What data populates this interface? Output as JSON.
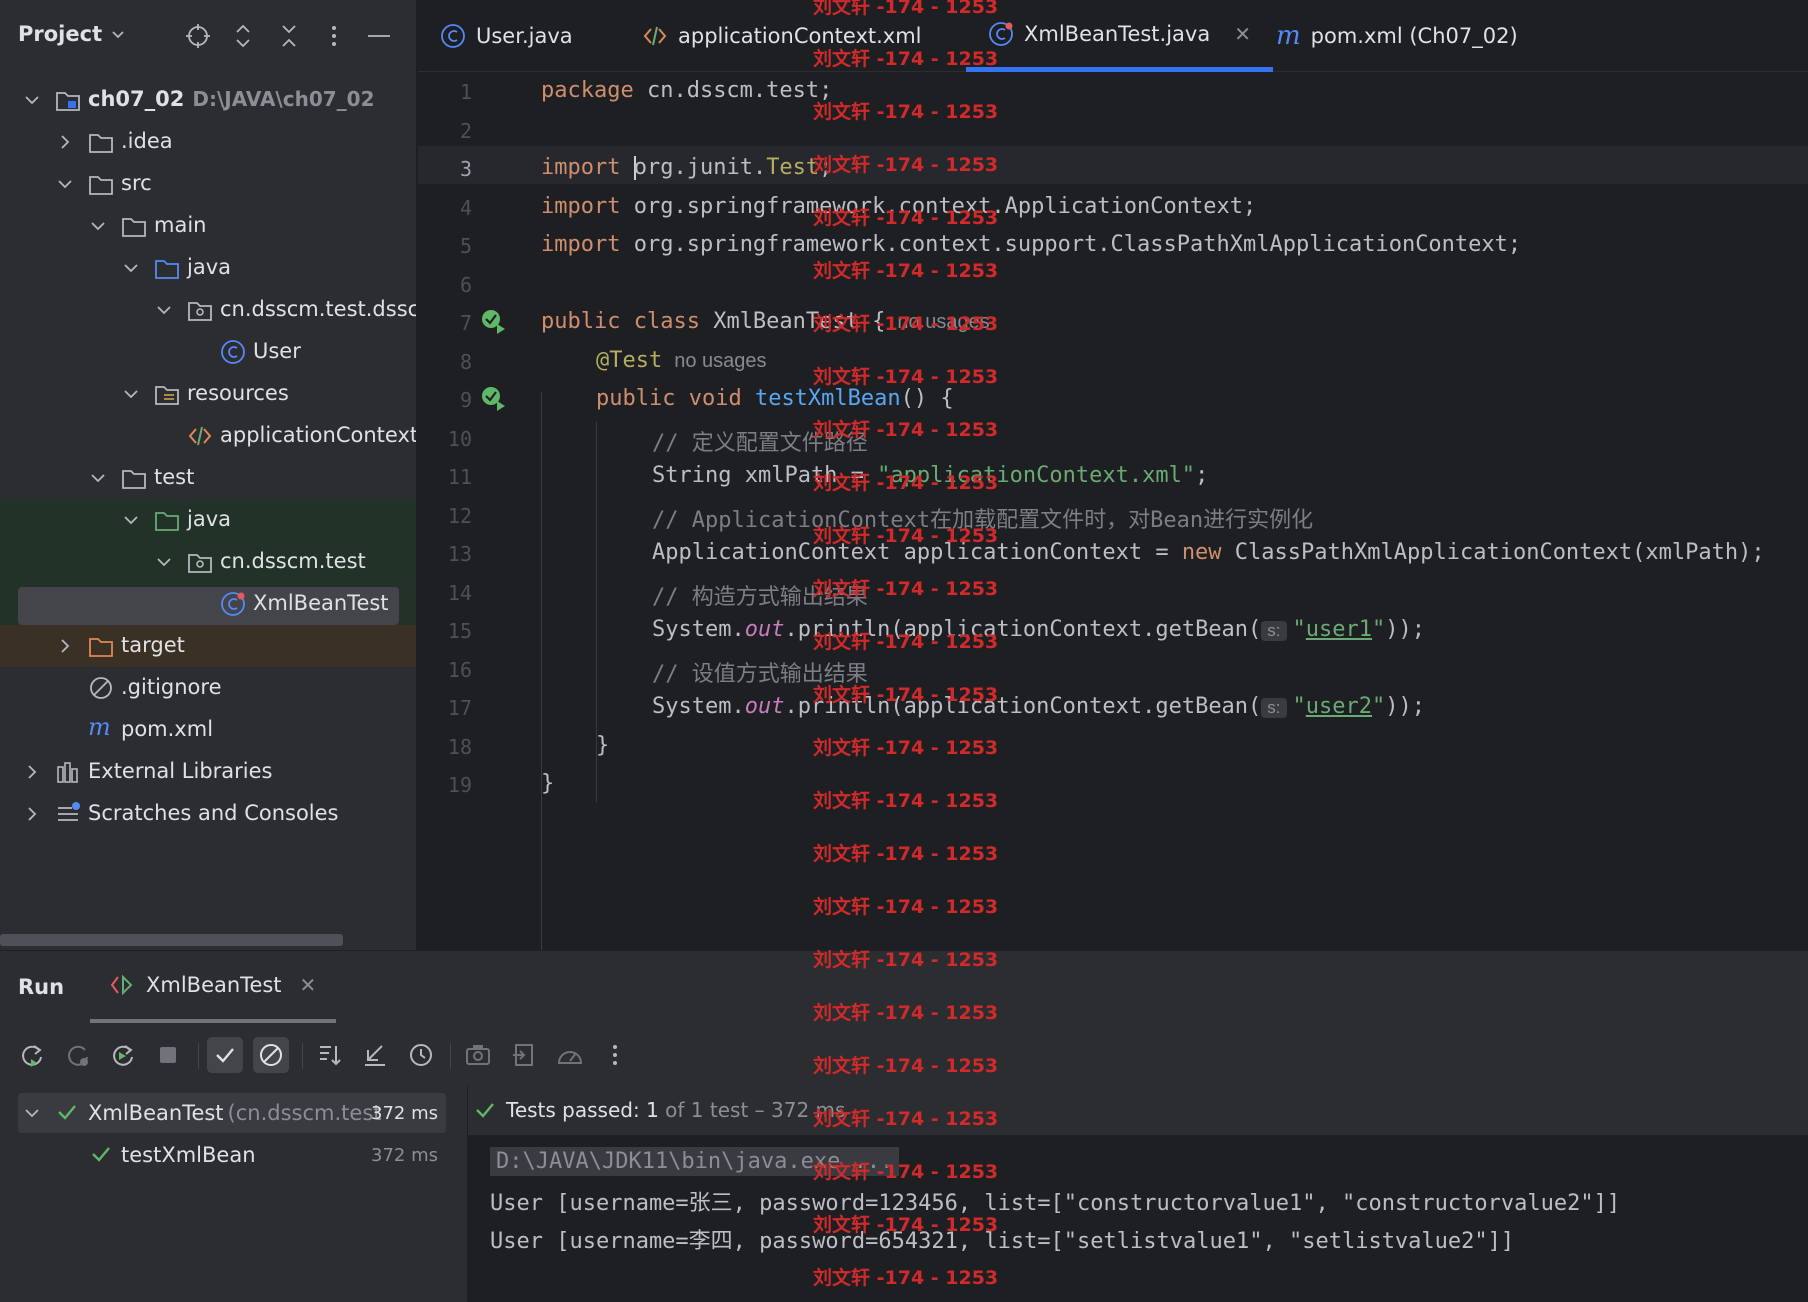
{
  "project_panel": {
    "title": "Project",
    "root": {
      "name": "ch07_02",
      "path": "D:\\JAVA\\ch07_02"
    },
    "items": [
      {
        "label": ".idea"
      },
      {
        "label": "src"
      },
      {
        "label": "main"
      },
      {
        "label": "java"
      },
      {
        "label": "cn.dsscm.test.dsscn"
      },
      {
        "label": "User"
      },
      {
        "label": "resources"
      },
      {
        "label": "applicationContext."
      },
      {
        "label": "test"
      },
      {
        "label": "java"
      },
      {
        "label": "cn.dsscm.test"
      },
      {
        "label": "XmlBeanTest"
      },
      {
        "label": "target"
      },
      {
        "label": ".gitignore"
      },
      {
        "label": "pom.xml"
      },
      {
        "label": "External Libraries"
      },
      {
        "label": "Scratches and Consoles"
      }
    ]
  },
  "editor_tabs": [
    {
      "label": "User.java",
      "icon": "class-icon"
    },
    {
      "label": "applicationContext.xml",
      "icon": "xml-icon"
    },
    {
      "label": "XmlBeanTest.java",
      "icon": "test-class-icon",
      "active": true
    },
    {
      "label": "pom.xml (Ch07_02)",
      "icon": "maven-icon"
    }
  ],
  "editor": {
    "line_numbers": [
      "1",
      "2",
      "3",
      "4",
      "5",
      "6",
      "7",
      "8",
      "9",
      "10",
      "11",
      "12",
      "13",
      "14",
      "15",
      "16",
      "17",
      "18",
      "19"
    ],
    "current_line": "3",
    "code": {
      "l1_kw": "package",
      "l1_rest": " cn.dsscm.test;",
      "l3_kw": "import",
      "l3_a": "org.junit.",
      "l3_b": "Test",
      "l3_c": ";",
      "l4_kw": "import",
      "l4_rest": " org.springframework.context.ApplicationContext;",
      "l5_kw": "import",
      "l5_rest": " org.springframework.context.support.ClassPathXmlApplicationContext;",
      "l7_kw": "public class",
      "l7_rest": " XmlBeanTest {",
      "l7_hint": "no usages",
      "l8_ann": "@Test",
      "l8_hint": "no usages",
      "l9_kw": "public void",
      "l9_fn": " testXmlBean",
      "l9_rest": "() {",
      "l10": "// 定义配置文件路径",
      "l11_a": "String xmlPath = ",
      "l11_str": "\"applicationContext.xml\"",
      "l11_b": ";",
      "l12": "// ApplicationContext在加载配置文件时，对Bean进行实例化",
      "l13_a": "ApplicationContext applicationContext = ",
      "l13_kw": "new",
      "l13_b": " ClassPathXmlApplicationContext(xmlPath);",
      "l14": "// 构造方式输出结果",
      "l15_a": "System.",
      "l15_fld": "out",
      "l15_b": ".println(applicationContext.getBean(",
      "l15_param": "s:",
      "l15_q1": "\"",
      "l15_str": "user1",
      "l15_q2": "\"",
      "l15_c": "));",
      "l16": "// 设值方式输出结果",
      "l17_a": "System.",
      "l17_fld": "out",
      "l17_b": ".println(applicationContext.getBean(",
      "l17_param": "s:",
      "l17_q1": "\"",
      "l17_str": "user2",
      "l17_q2": "\"",
      "l17_c": "));",
      "l18": "}",
      "l19": "}"
    }
  },
  "watermark": "刘文轩 -174 - 1253",
  "run_panel": {
    "title": "Run",
    "tab_label": "XmlBeanTest",
    "tests": [
      {
        "name": "XmlBeanTest",
        "pkg": "(cn.dsscm.test",
        "duration": "372 ms"
      },
      {
        "name": "testXmlBean",
        "duration": "372 ms"
      }
    ],
    "status": {
      "prefix": "Tests passed:",
      "count": "1",
      "suffix": "of 1 test – 372 ms"
    },
    "console": [
      "D:\\JAVA\\JDK11\\bin\\java.exe ...",
      "User [username=张三, password=123456, list=[\"constructorvalue1\", \"constructorvalue2\"]]",
      "User [username=李四, password=654321, list=[\"setlistvalue1\", \"setlistvalue2\"]]"
    ]
  },
  "colors": {
    "accent": "#3574f0",
    "pass": "#5fb865",
    "watermark": "#d02a2a"
  }
}
